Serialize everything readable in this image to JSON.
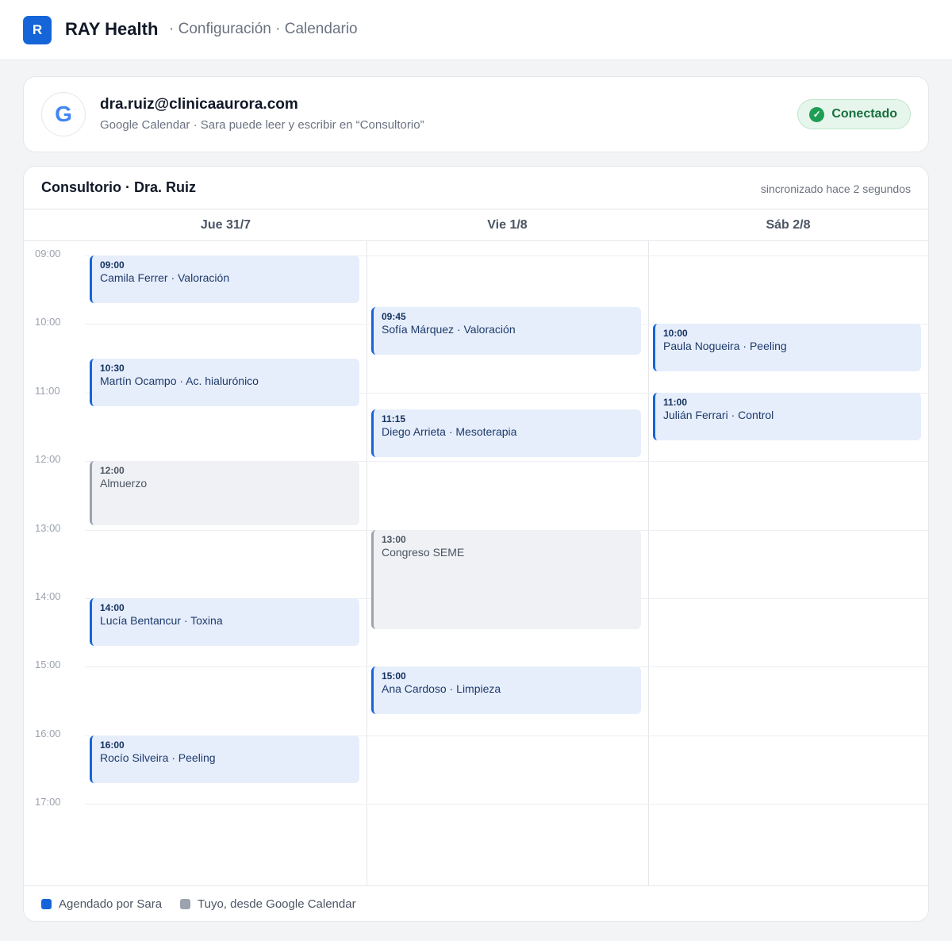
{
  "header": {
    "logo_letter": "R",
    "brand": "RAY Health",
    "breadcrumb": "· Configuración · Calendario"
  },
  "account": {
    "avatar_letter": "G",
    "email": "dra.ruiz@clinicaaurora.com",
    "description": "Google Calendar · Sara puede leer y escribir en “Consultorio”",
    "status": "Conectado",
    "status_icon": "check-icon"
  },
  "calendar": {
    "title": "Consultorio · Dra. Ruiz",
    "sync_status": "sincronizado hace 2 segundos",
    "days": [
      "Jue 31/7",
      "Vie 1/8",
      "Sáb 2/8"
    ],
    "hours": [
      "09:00",
      "10:00",
      "11:00",
      "12:00",
      "13:00",
      "14:00",
      "15:00",
      "16:00",
      "17:00"
    ],
    "events": [
      {
        "day": 0,
        "time": "09:00",
        "title": "Camila Ferrer · Valoración",
        "source": "sara",
        "duration_min": 45
      },
      {
        "day": 0,
        "time": "10:30",
        "title": "Martín Ocampo · Ac. hialurónico",
        "source": "sara",
        "duration_min": 45
      },
      {
        "day": 0,
        "time": "12:00",
        "title": "Almuerzo",
        "source": "google",
        "duration_min": 60
      },
      {
        "day": 0,
        "time": "14:00",
        "title": "Lucía Bentancur · Toxina",
        "source": "sara",
        "duration_min": 45
      },
      {
        "day": 0,
        "time": "16:00",
        "title": "Rocío Silveira · Peeling",
        "source": "sara",
        "duration_min": 45
      },
      {
        "day": 1,
        "time": "09:45",
        "title": "Sofía Márquez · Valoración",
        "source": "sara",
        "duration_min": 45
      },
      {
        "day": 1,
        "time": "11:15",
        "title": "Diego Arrieta · Mesoterapia",
        "source": "sara",
        "duration_min": 45
      },
      {
        "day": 1,
        "time": "13:00",
        "title": "Congreso SEME",
        "source": "google",
        "duration_min": 90
      },
      {
        "day": 1,
        "time": "15:00",
        "title": "Ana Cardoso · Limpieza",
        "source": "sara",
        "duration_min": 45
      },
      {
        "day": 2,
        "time": "10:00",
        "title": "Paula Nogueira · Peeling",
        "source": "sara",
        "duration_min": 45
      },
      {
        "day": 2,
        "time": "11:00",
        "title": "Julián Ferrari · Control",
        "source": "sara",
        "duration_min": 45
      }
    ]
  },
  "legend": [
    {
      "label": "Agendado por Sara",
      "color": "#1565d8"
    },
    {
      "label": "Tuyo, desde Google Calendar",
      "color": "#9ca3af"
    }
  ]
}
